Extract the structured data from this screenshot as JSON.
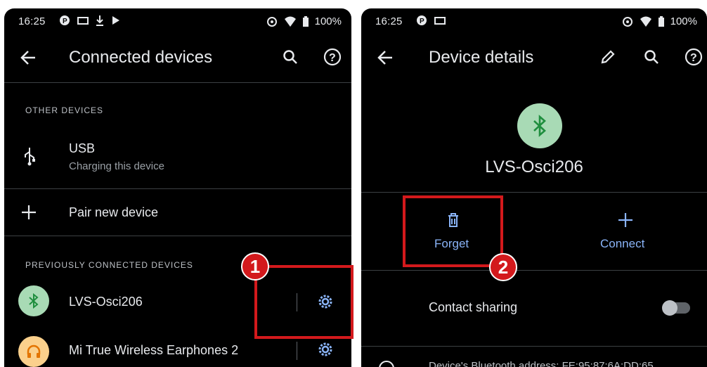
{
  "left": {
    "status": {
      "time": "16:25",
      "battery": "100%"
    },
    "title": "Connected devices",
    "section_other": "OTHER DEVICES",
    "usb": {
      "title": "USB",
      "subtitle": "Charging this device"
    },
    "pair": "Pair new device",
    "section_prev": "PREVIOUSLY CONNECTED DEVICES",
    "devices": [
      {
        "name": "LVS-Osci206",
        "icon": "bluetooth-icon"
      },
      {
        "name": "Mi True Wireless Earphones 2",
        "icon": "headphones-icon"
      }
    ],
    "badge": "1"
  },
  "right": {
    "status": {
      "time": "16:25",
      "battery": "100%"
    },
    "title": "Device details",
    "device_name": "LVS-Osci206",
    "forget": "Forget",
    "connect": "Connect",
    "contact_sharing": "Contact sharing",
    "footer_text": "Device's Bluetooth address: FE:95:87:6A:DD:65",
    "badge": "2"
  },
  "colors": {
    "accent": "#8ab4f8",
    "highlight": "#d3191c",
    "bt_bg": "#a8dab5",
    "bt_icon": "#1e8e3e",
    "earphone_bg": "#fbd08c"
  }
}
